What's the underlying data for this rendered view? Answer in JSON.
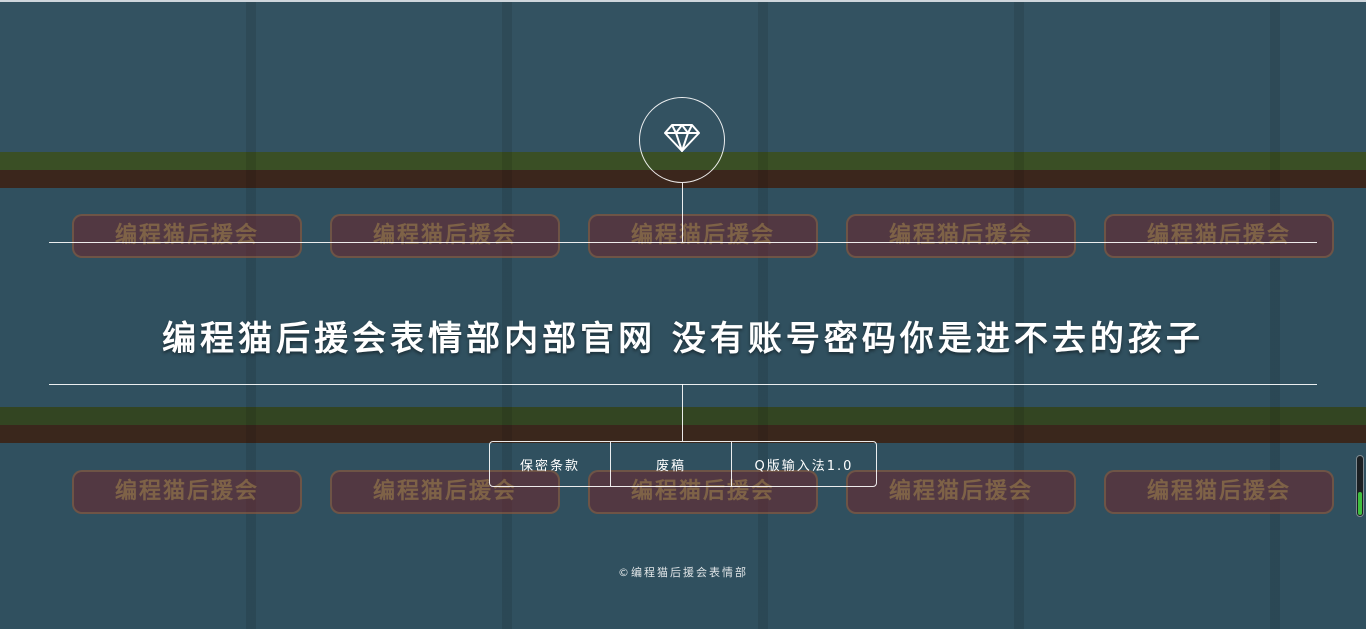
{
  "header": {
    "logo_icon": "diamond-icon"
  },
  "hero": {
    "title": "编程猫后援会表情部内部官网 没有账号密码你是进不去的孩子"
  },
  "menu": {
    "items": [
      {
        "label": "保密条款"
      },
      {
        "label": "废稿"
      },
      {
        "label": "Q版输入法1.0"
      }
    ]
  },
  "footer": {
    "text": "©编程猫后援会表情部"
  },
  "background": {
    "tile_text": "编程猫后援会"
  },
  "scroll_indicator": {
    "value": 0.38
  },
  "colors": {
    "overlay": "#000000",
    "text": "#ffffff",
    "accent": "#3fbf3f"
  }
}
